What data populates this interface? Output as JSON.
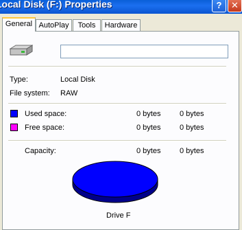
{
  "window": {
    "title": "Local Disk (F:) Properties",
    "help_button": "?",
    "close_button": "✕"
  },
  "tabs": [
    {
      "label": "General",
      "active": true
    },
    {
      "label": "AutoPlay",
      "active": false
    },
    {
      "label": "Tools",
      "active": false
    },
    {
      "label": "Hardware",
      "active": false
    }
  ],
  "general": {
    "drive_icon": "drive-icon",
    "name_value": "",
    "type_label": "Type:",
    "type_value": "Local Disk",
    "fs_label": "File system:",
    "fs_value": "RAW",
    "used": {
      "label": "Used space:",
      "bytes": "0 bytes",
      "size": "0 bytes",
      "color": "#0000ff"
    },
    "free": {
      "label": "Free space:",
      "bytes": "0 bytes",
      "size": "0 bytes",
      "color": "#ff00ff"
    },
    "capacity": {
      "label": "Capacity:",
      "bytes": "0 bytes",
      "size": "0 bytes"
    },
    "pie": {
      "used_fraction": 1.0,
      "color": "#0000ff",
      "side_color": "#00008b"
    },
    "drive_label": "Drive F"
  }
}
